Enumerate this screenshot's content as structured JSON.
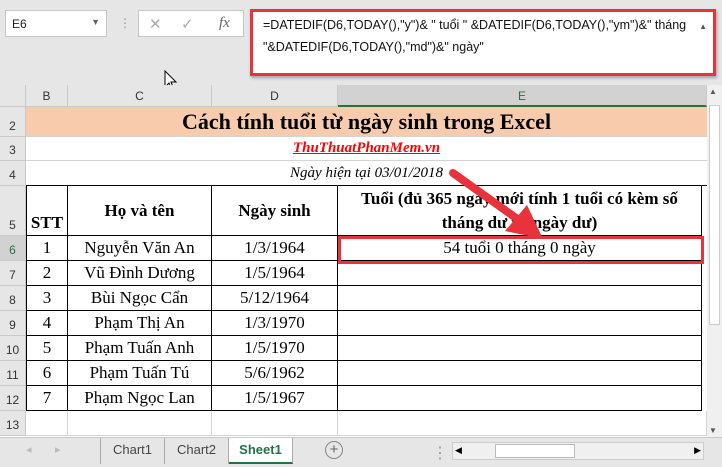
{
  "formula_bar": {
    "name_box": "E6",
    "cancel_icon": "✕",
    "enter_icon": "✓",
    "fx_label": "fx",
    "formula": "=DATEDIF(D6,TODAY(),\"y\")& \" tuổi \" &DATEDIF(D6,TODAY(),\"ym\")&\" tháng \"&DATEDIF(D6,TODAY(),\"md\")&\" ngày\""
  },
  "columns": [
    "B",
    "C",
    "D",
    "E"
  ],
  "rows": [
    "2",
    "3",
    "4",
    "5",
    "6",
    "7",
    "8",
    "9",
    "10",
    "11",
    "12",
    "13"
  ],
  "sheet": {
    "title": "Cách tính tuổi từ ngày sinh trong Excel",
    "site": "ThuThuatPhanMem.vn",
    "current_date": "Ngày hiện tại 03/01/2018",
    "headers": [
      "STT",
      "Họ và tên",
      "Ngày sinh",
      "Tuổi (đủ 365 ngày mới tính 1 tuổi có kèm số tháng dư và ngày dư)"
    ],
    "data": [
      [
        "1",
        "Nguyễn Văn An",
        "1/3/1964",
        "54 tuổi 0 tháng 0 ngày"
      ],
      [
        "2",
        "Vũ Đình Dương",
        "1/5/1964",
        ""
      ],
      [
        "3",
        "Bùi Ngọc Cẩn",
        "5/12/1964",
        ""
      ],
      [
        "4",
        "Phạm Thị An",
        "1/3/1970",
        ""
      ],
      [
        "5",
        "Phạm Tuấn Anh",
        "1/5/1970",
        ""
      ],
      [
        "6",
        "Phạm Tuấn Tú",
        "5/6/1962",
        ""
      ],
      [
        "7",
        "Phạm Ngọc Lan",
        "1/5/1967",
        ""
      ]
    ]
  },
  "tabs": [
    "Chart1",
    "Chart2",
    "Sheet1"
  ],
  "active_tab": "Sheet1",
  "colors": {
    "title_bg": "#F8CBAD",
    "site_link": "#FF0000",
    "highlight": "#E8323C",
    "excel_green": "#217346"
  }
}
